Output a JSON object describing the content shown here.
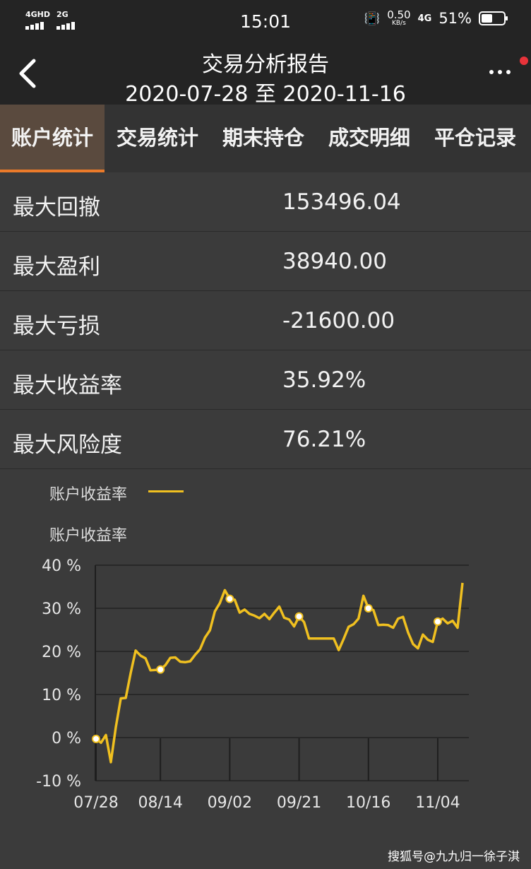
{
  "status": {
    "sig1": "4GHD",
    "sig2": "2G",
    "time": "15:01",
    "speed": "0.50",
    "speed_unit": "KB/s",
    "net": "4G",
    "battery": "51%"
  },
  "header": {
    "title": "交易分析报告",
    "subtitle": "2020-07-28 至 2020-11-16"
  },
  "tabs": [
    {
      "label": "账户统计",
      "active": true
    },
    {
      "label": "交易统计"
    },
    {
      "label": "期末持仓"
    },
    {
      "label": "成交明细"
    },
    {
      "label": "平仓记录"
    }
  ],
  "stats": [
    {
      "label": "最大回撤",
      "value": "153496.04"
    },
    {
      "label": "最大盈利",
      "value": "38940.00"
    },
    {
      "label": "最大亏损",
      "value": "-21600.00"
    },
    {
      "label": "最大收益率",
      "value": "35.92%"
    },
    {
      "label": "最大风险度",
      "value": "76.21%"
    }
  ],
  "chart_data": {
    "type": "line",
    "title": "账户收益率",
    "xlabel": "",
    "ylabel": "",
    "ylim": [
      -10,
      40
    ],
    "yticks": [
      40,
      30,
      20,
      10,
      0,
      -10
    ],
    "ytick_labels": [
      "40 %",
      "30 %",
      "20 %",
      "10 %",
      "0 %",
      "-10 %"
    ],
    "xtick_labels": [
      "07/28",
      "08/14",
      "09/02",
      "09/21",
      "10/16",
      "11/04"
    ],
    "xtick_index": [
      0,
      13,
      27,
      41,
      55,
      69
    ],
    "grid": true,
    "legend": "top-left",
    "color": "#f0c020",
    "series": [
      {
        "name": "账户收益率",
        "values": [
          -0.3,
          -1.2,
          0.6,
          -5.7,
          2.5,
          9.1,
          9.2,
          15.0,
          20.2,
          19.0,
          18.4,
          15.6,
          15.7,
          15.8,
          16.8,
          18.5,
          18.6,
          17.6,
          17.5,
          17.7,
          19.2,
          20.5,
          23.2,
          24.9,
          29.3,
          31.2,
          34.2,
          32.2,
          32.0,
          29.0,
          29.7,
          28.7,
          28.3,
          27.7,
          28.7,
          27.5,
          29.0,
          30.4,
          27.8,
          27.4,
          25.8,
          28.1,
          26.8,
          23.0,
          23.0,
          23.0,
          23.0,
          23.0,
          23.0,
          20.3,
          22.9,
          25.7,
          26.3,
          27.6,
          32.9,
          30.0,
          29.6,
          26.1,
          26.2,
          26.1,
          25.5,
          27.6,
          28.0,
          24.4,
          21.7,
          20.7,
          23.9,
          22.7,
          22.2,
          26.9,
          27.6,
          26.5,
          27.1,
          25.5,
          35.9
        ],
        "markers": [
          0,
          13,
          27,
          41,
          55,
          69
        ]
      }
    ]
  },
  "watermark": "搜狐号@九九归一徐子淇"
}
